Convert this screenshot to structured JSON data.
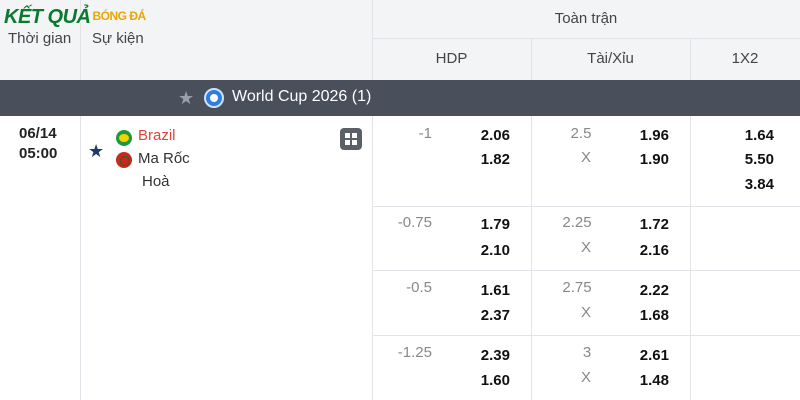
{
  "header": {
    "logo_main": "KẾT QUẢ",
    "logo_sub": "BÓNG ĐÁ",
    "col_time": "Thời gian",
    "col_event": "Sự kiện",
    "full_match": "Toàn trận",
    "col_hdp": "HDP",
    "col_ou": "Tài/Xỉu",
    "col_1x2": "1X2"
  },
  "league": {
    "name": "World Cup 2026 (1)"
  },
  "match": {
    "date": "06/14",
    "time": "05:00",
    "home": "Brazil",
    "away": "Ma Rốc",
    "draw": "Hoà"
  },
  "odds_rows": [
    {
      "hdp_line": "-1",
      "hdp_home": "2.06",
      "hdp_away": "1.82",
      "ou_line": "2.5",
      "ou_x": "X",
      "ou_over": "1.96",
      "ou_under": "1.90"
    },
    {
      "hdp_line": "-0.75",
      "hdp_home": "1.79",
      "hdp_away": "2.10",
      "ou_line": "2.25",
      "ou_x": "X",
      "ou_over": "1.72",
      "ou_under": "2.16"
    },
    {
      "hdp_line": "-0.5",
      "hdp_home": "1.61",
      "hdp_away": "2.37",
      "ou_line": "2.75",
      "ou_x": "X",
      "ou_over": "2.22",
      "ou_under": "1.68"
    },
    {
      "hdp_line": "-1.25",
      "hdp_home": "2.39",
      "hdp_away": "1.60",
      "ou_line": "3",
      "ou_x": "X",
      "ou_over": "2.61",
      "ou_under": "1.48"
    }
  ],
  "one_x_two": {
    "home": "1.64",
    "draw": "5.50",
    "away": "3.84"
  },
  "colors": {
    "league_bar": "#4a4f5c",
    "home_team": "#e0453a",
    "header_bg": "#f3f4f6"
  }
}
